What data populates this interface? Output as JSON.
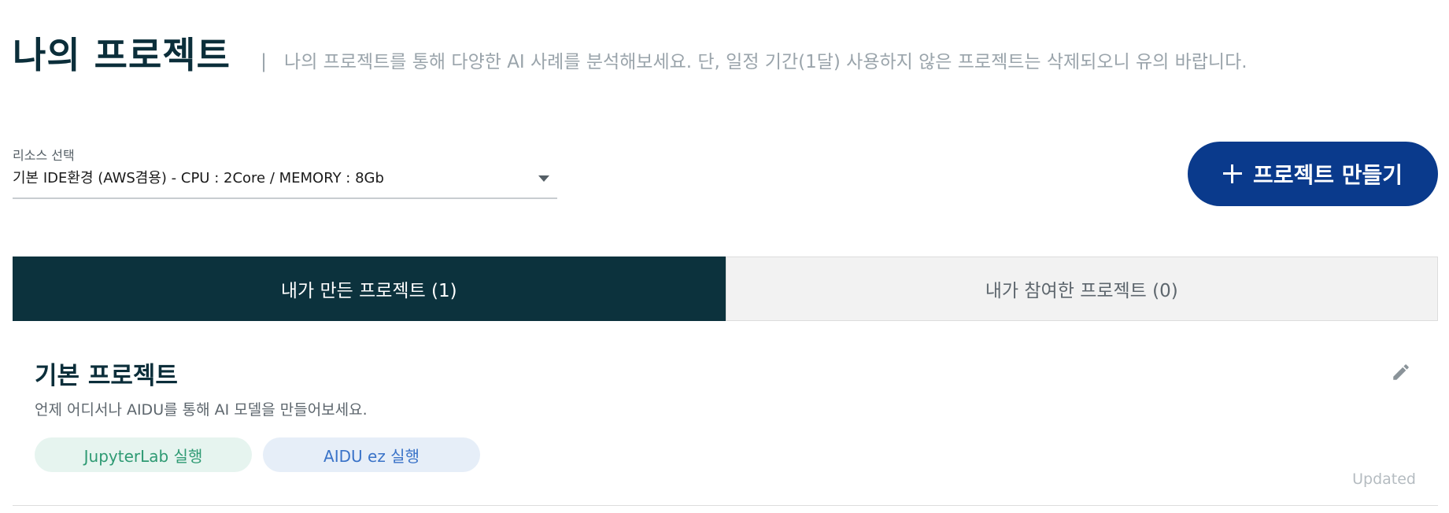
{
  "header": {
    "title": "나의 프로젝트",
    "separator": "|",
    "description": "나의 프로젝트를 통해 다양한 AI 사례를 분석해보세요. 단, 일정 기간(1달) 사용하지 않은 프로젝트는 삭제되오니 유의 바랍니다."
  },
  "resource": {
    "label": "리소스 선택",
    "selected": "기본 IDE환경 (AWS겸용) - CPU : 2Core / MEMORY : 8Gb"
  },
  "create_button": {
    "label": "프로젝트 만들기"
  },
  "tabs": [
    {
      "label": "내가 만든 프로젝트 (1)",
      "active": true
    },
    {
      "label": "내가 참여한 프로젝트 (0)",
      "active": false
    }
  ],
  "projects": [
    {
      "name": "기본 프로젝트",
      "description": "언제 어디서나 AIDU를 통해 AI 모델을 만들어보세요.",
      "jupyter_label": "JupyterLab 실행",
      "aidu_label": "AIDU ez 실행",
      "updated_label": "Updated"
    }
  ],
  "colors": {
    "primary": "#0a3a8c",
    "tab_active": "#0c323d",
    "jupyter": "#2e9a73",
    "aidu": "#3a73c8"
  }
}
